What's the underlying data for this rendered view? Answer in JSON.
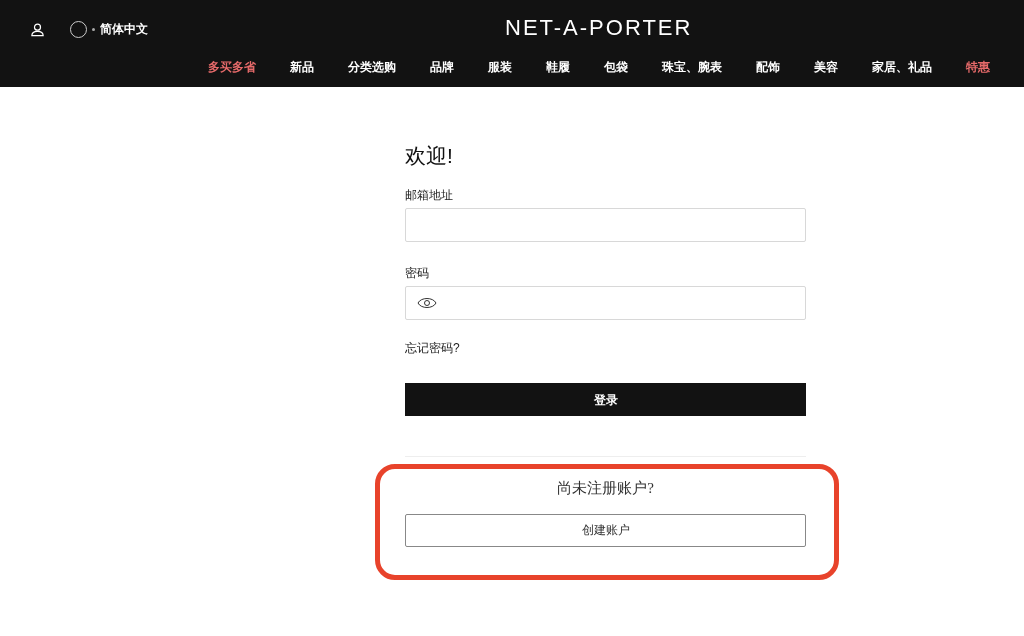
{
  "header": {
    "language": "简体中文",
    "logo": "NET-A-PORTER",
    "nav": [
      {
        "label": "多买多省",
        "highlighted": true
      },
      {
        "label": "新品",
        "highlighted": false
      },
      {
        "label": "分类选购",
        "highlighted": false
      },
      {
        "label": "品牌",
        "highlighted": false
      },
      {
        "label": "服装",
        "highlighted": false
      },
      {
        "label": "鞋履",
        "highlighted": false
      },
      {
        "label": "包袋",
        "highlighted": false
      },
      {
        "label": "珠宝、腕表",
        "highlighted": false
      },
      {
        "label": "配饰",
        "highlighted": false
      },
      {
        "label": "美容",
        "highlighted": false
      },
      {
        "label": "家居、礼品",
        "highlighted": false
      },
      {
        "label": "特惠",
        "highlighted": true
      }
    ]
  },
  "login": {
    "title": "欢迎!",
    "email_label": "邮箱地址",
    "password_label": "密码",
    "forgot_link": "忘记密码?",
    "submit": "登录"
  },
  "register": {
    "prompt": "尚未注册账户?",
    "button": "创建账户",
    "annotated": true
  }
}
